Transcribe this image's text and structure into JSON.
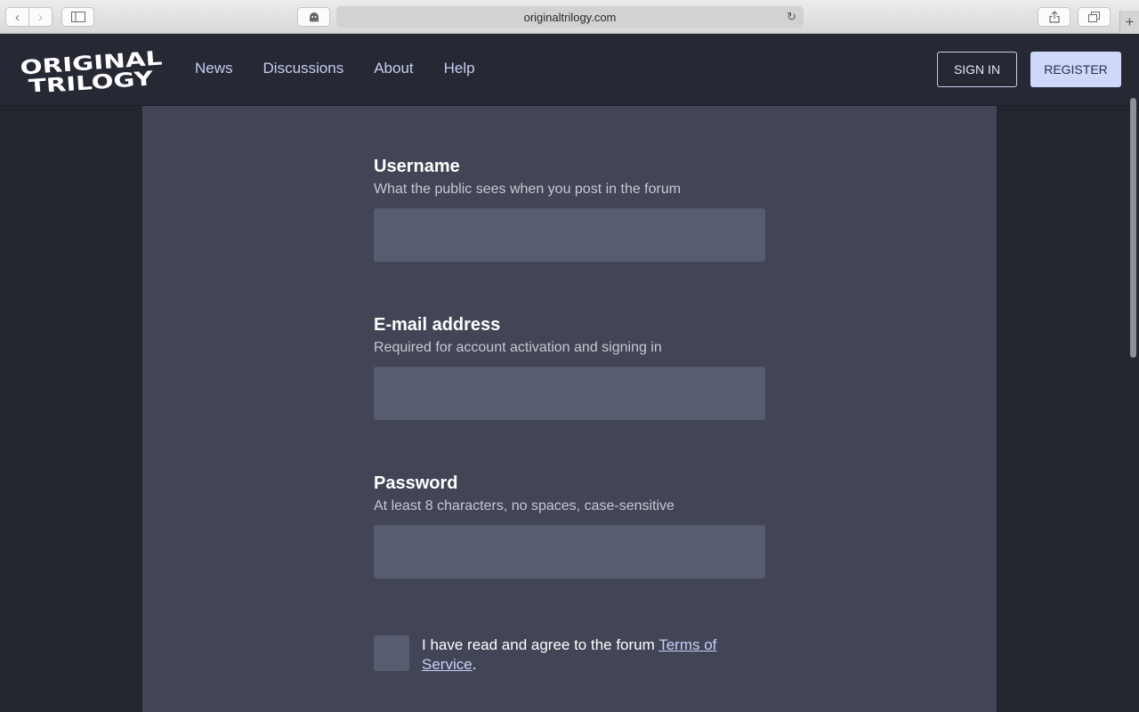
{
  "browser": {
    "url": "originaltrilogy.com",
    "back_icon": "chevron-left-icon",
    "forward_icon": "chevron-right-icon",
    "sidebar_icon": "sidebar-icon",
    "extension_icon": "ghost-icon",
    "reload_icon": "reload-icon",
    "share_icon": "share-icon",
    "tabs_icon": "tabs-icon",
    "new_tab_icon": "plus-icon"
  },
  "header": {
    "logo_line1": "ORIGINAL",
    "logo_line2": "TRILOGY",
    "nav": [
      "News",
      "Discussions",
      "About",
      "Help"
    ],
    "sign_in": "SIGN IN",
    "register": "REGISTER"
  },
  "form": {
    "username": {
      "label": "Username",
      "hint": "What the public sees when you post in the forum",
      "value": ""
    },
    "email": {
      "label": "E-mail address",
      "hint": "Required for account activation and signing in",
      "value": ""
    },
    "password": {
      "label": "Password",
      "hint": "At least 8 characters, no spaces, case-sensitive",
      "value": ""
    },
    "agree": {
      "text": "I have read and agree to the forum ",
      "link": "Terms of Service",
      "suffix": ".",
      "checked": false
    }
  },
  "colors": {
    "header_bg": "#262833",
    "panel_bg": "#414555",
    "input_bg": "#575c70",
    "accent": "#cfd7fb",
    "nav_link": "#c5cdf2"
  }
}
